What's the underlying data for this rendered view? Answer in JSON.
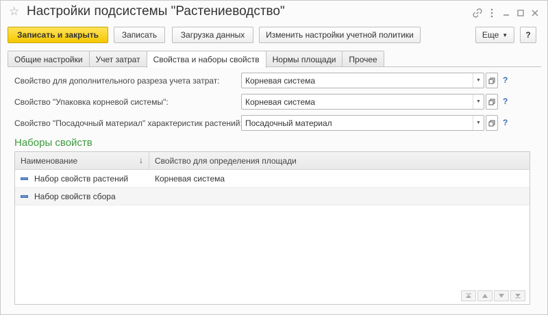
{
  "window": {
    "title": "Настройки подсистемы \"Растениеводство\""
  },
  "toolbar": {
    "save_close_label": "Записать и закрыть",
    "save_label": "Записать",
    "load_data_label": "Загрузка данных",
    "change_policy_label": "Изменить настройки учетной политики",
    "more_label": "Еще",
    "help_label": "?"
  },
  "tabs": [
    {
      "label": "Общие настройки"
    },
    {
      "label": "Учет затрат"
    },
    {
      "label": "Свойства и наборы свойств"
    },
    {
      "label": "Нормы площади"
    },
    {
      "label": "Прочее"
    }
  ],
  "fields": [
    {
      "label": "Свойство для дополнительного разреза учета затрат:",
      "value": "Корневая система"
    },
    {
      "label": "Свойство \"Упаковка корневой системы\":",
      "value": "Корневая система"
    },
    {
      "label": "Свойство \"Посадочный материал\" характеристик растений:",
      "value": "Посадочный материал"
    }
  ],
  "help_mark": "?",
  "property_sets": {
    "title": "Наборы свойств",
    "columns": [
      "Наименование",
      "Свойство для определения площади"
    ],
    "sort_indicator": "↓",
    "rows": [
      {
        "name": "Набор свойств растений",
        "area_property": "Корневая система"
      },
      {
        "name": "Набор свойств сбора",
        "area_property": ""
      }
    ]
  },
  "colors": {
    "primary_button": "#f5c800",
    "section_title": "#3d9a3d",
    "help_mark": "#3f6fb5"
  },
  "icons": [
    "star-icon",
    "link-icon",
    "kebab-menu-icon",
    "minimize-icon",
    "maximize-icon",
    "close-icon",
    "dropdown-icon",
    "open-icon",
    "list-item-icon",
    "move-first-icon",
    "move-up-icon",
    "move-down-icon",
    "move-last-icon"
  ]
}
